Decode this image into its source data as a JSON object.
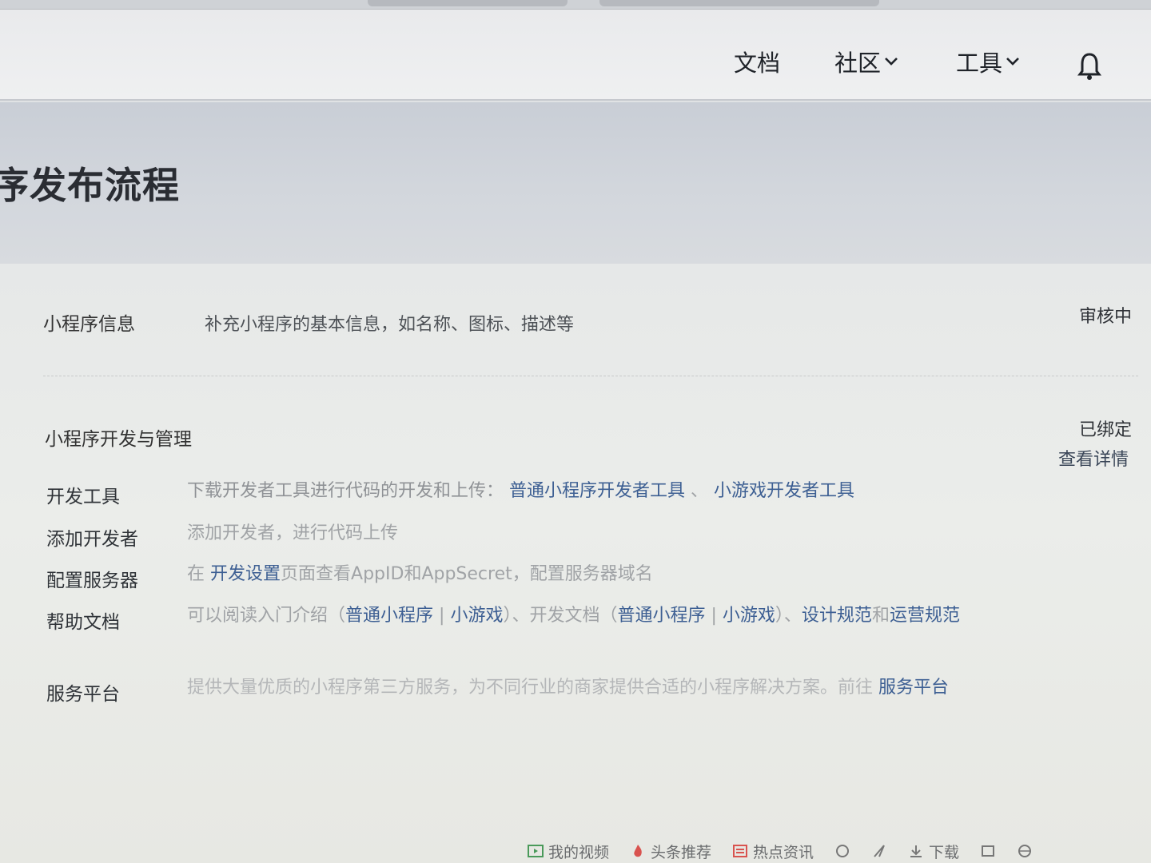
{
  "nav": {
    "docs": "文档",
    "community": "社区",
    "tools": "工具",
    "chevron": "⌄"
  },
  "page": {
    "title": "序发布流程"
  },
  "section1": {
    "label": "小程序信息",
    "desc": "补充小程序的基本信息，如名称、图标、描述等",
    "status": "审核中"
  },
  "section2": {
    "label": "小程序开发与管理",
    "status": "已绑定",
    "detail_link": "查看详情",
    "rows": {
      "devtools": {
        "label": "开发工具",
        "text": "下载开发者工具进行代码的开发和上传：",
        "link1": "普通小程序开发者工具",
        "sep": "、",
        "link2": "小游戏开发者工具"
      },
      "add_dev": {
        "label": "添加开发者",
        "text": "添加开发者，进行代码上传"
      },
      "server": {
        "label": "配置服务器",
        "text_pre": "在",
        "link": "开发设置",
        "text_post": "页面查看AppID和AppSecret，配置服务器域名"
      },
      "help": {
        "label": "帮助文档",
        "t1": "可以阅读入门介绍（",
        "l1": "普通小程序",
        "bar1": " | ",
        "l2": "小游戏",
        "t2": "）、开发文档（",
        "l3": "普通小程序",
        "bar2": " | ",
        "l4": "小游戏",
        "t3": "）、",
        "l5": "设计规范",
        "t4": "和",
        "l6": "运营规范"
      },
      "platform": {
        "label": "服务平台",
        "text": "提供大量优质的小程序第三方服务，为不同行业的商家提供合适的小程序解决方案。前往",
        "link": "服务平台"
      }
    }
  },
  "taskbar": {
    "video": "我的视频",
    "news": "头条推荐",
    "hot": "热点资讯",
    "download": "下载"
  },
  "colors": {
    "link": "#3d5f93",
    "muted": "#a0a3a6",
    "text": "#2f3338"
  }
}
